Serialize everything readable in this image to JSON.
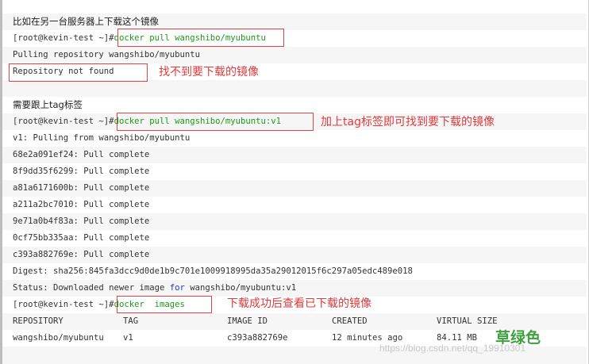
{
  "intro_1": "比如在另一台服务器上下载这个镜像",
  "prompt": "[root@kevin-test ~]#",
  "cmd_1": "docker pull wangshibo/myubuntu",
  "out_pulling": "Pulling repository wangshibo/myubuntu",
  "out_notfound": "Repository not found",
  "note_notfound": "找不到要下载的镜像",
  "intro_2": "需要跟上tag标签",
  "cmd_2": "docker pull wangshibo/myubuntu:v1",
  "note_tag": "加上tag标签即可找到要下载的镜像",
  "out_v1": "v1: Pulling from wangshibo/myubuntu",
  "layers": [
    "68e2a091ef24: Pull complete",
    "8f9dd35f6299: Pull complete",
    "a81a6171600b: Pull complete",
    "a211a2bc7010: Pull complete",
    "9e71a0b4f83a: Pull complete",
    "0cf75bb335aa: Pull complete",
    "c393a882769e: Pull complete"
  ],
  "digest": "Digest: sha256:845fa3dcc9d0de1b9c701e1009918995da35a29012015f6c297a05edc489e018",
  "status_prefix": "Status: Downloaded newer image ",
  "status_for": "for",
  "status_suffix": " wangshibo/myubuntu:v1",
  "cmd_3": "docker  images",
  "note_images": "下载成功后查看已下载的镜像",
  "table": {
    "headers": [
      "REPOSITORY",
      "TAG",
      "IMAGE ID",
      "CREATED",
      "VIRTUAL SIZE"
    ],
    "row": [
      "wangshibo/myubuntu",
      "v1",
      "c393a882769e",
      "12 minutes ago",
      "84.11 MB"
    ]
  },
  "label_green": "草绿色",
  "watermark": "https://blog.csdn.net/qq_19910301",
  "colors": {
    "cmd_green": "#1a9a1a",
    "keyword_blue": "#2434d6",
    "annotation_red": "#e33a3a",
    "label_green": "#3fa13f"
  }
}
